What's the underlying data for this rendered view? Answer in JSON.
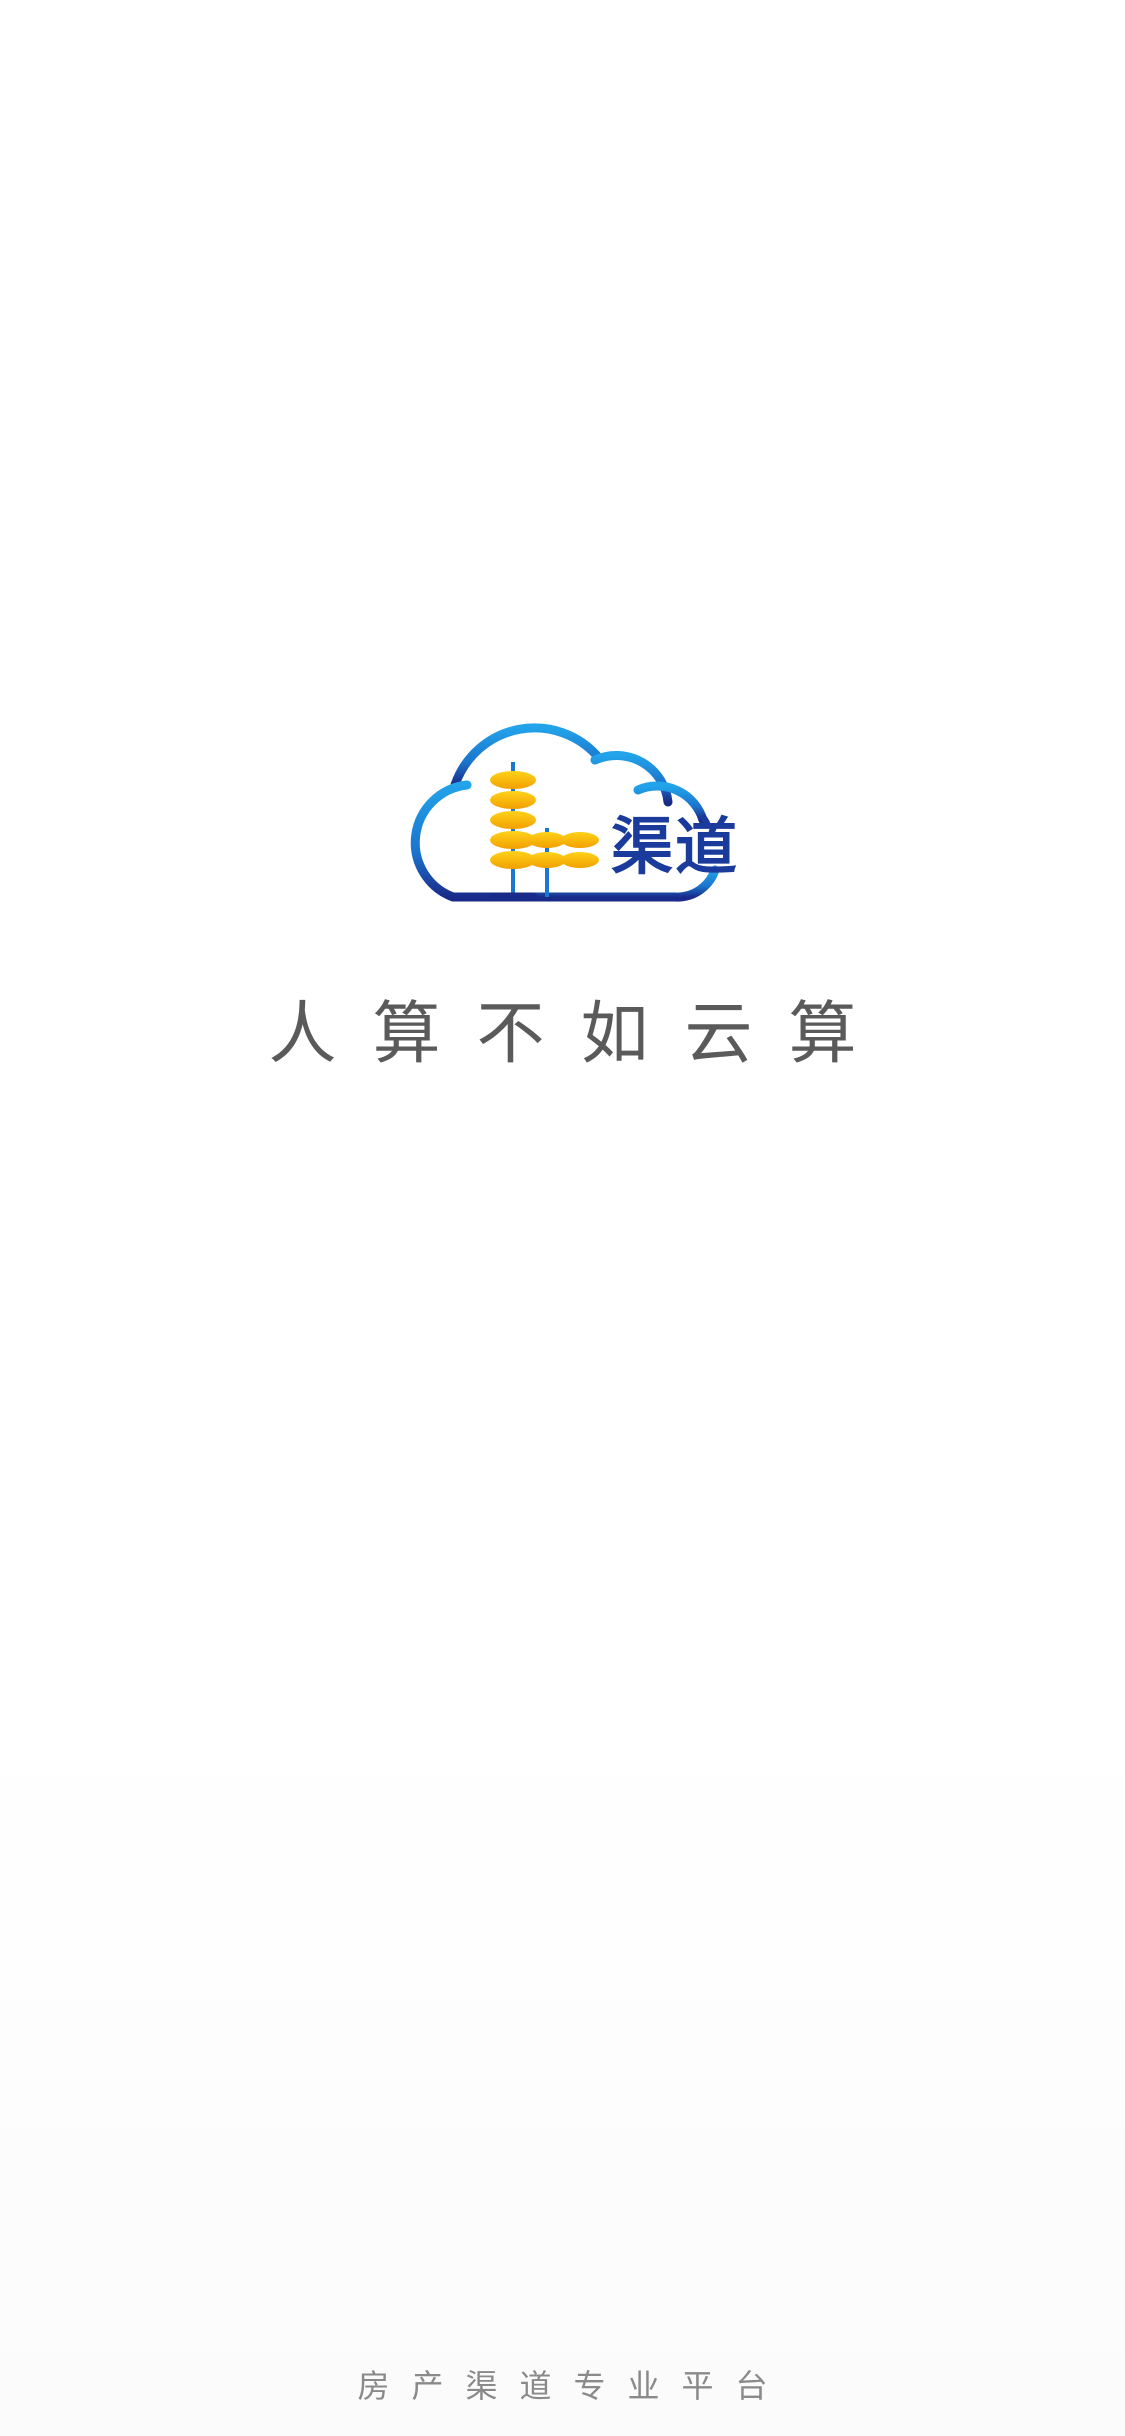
{
  "logo": {
    "text": "渠道",
    "cloud_color_start": "#1ea0e6",
    "cloud_color_end": "#1a2c8c",
    "bead_color": "#f5b400",
    "icon": "cloud-abacus-logo"
  },
  "slogan": "人算不如云算",
  "footer": "房产渠道专业平台"
}
